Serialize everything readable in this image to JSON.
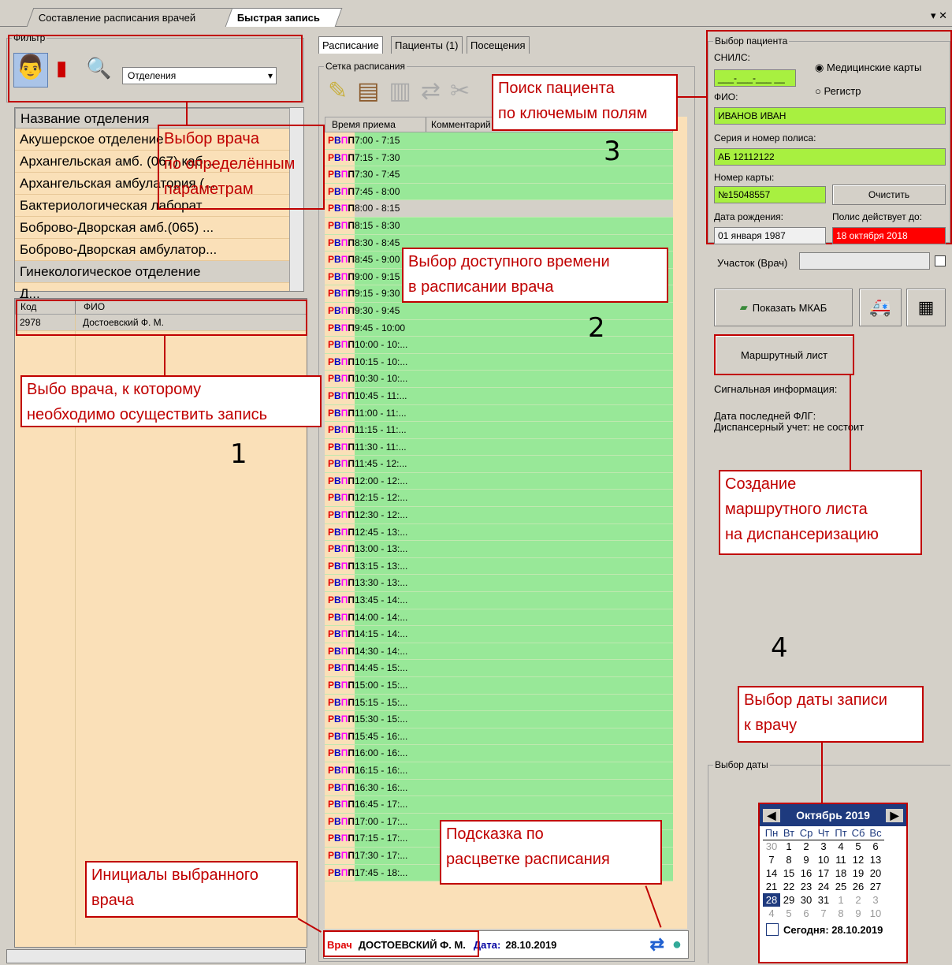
{
  "tabs": [
    "Составление расписания врачей",
    "Быстрая запись"
  ],
  "filter": {
    "title": "Фильтр",
    "select_value": "Отделения"
  },
  "departments": {
    "header": "Название отделения",
    "items": [
      "Акушерское отделение",
      "Архангельская амб. (067) каб...",
      "Архангельская амбулатория (...",
      "Бактериологическая лаборат...",
      "Боброво-Дворская амб.(065) ...",
      "Боброво-Дворская амбулатор...",
      "Гинекологическое отделение",
      "Д..."
    ]
  },
  "doctors": {
    "col_code": "Код",
    "col_fio": "ФИО",
    "rows": [
      {
        "code": "2978",
        "fio": "Достоевский Ф. М."
      }
    ]
  },
  "center_tabs": [
    "Расписание",
    "Пациенты (1)",
    "Посещения"
  ],
  "schedule": {
    "title": "Сетка расписания",
    "col_time": "Время приема",
    "col_comment": "Комментарий",
    "codes": [
      "Р",
      "В",
      "П",
      "П"
    ],
    "times": [
      "7:00 - 7:15",
      "7:15 - 7:30",
      "7:30 - 7:45",
      "7:45 - 8:00",
      "8:00 - 8:15",
      "8:15 - 8:30",
      "8:30 - 8:45",
      "8:45 - 9:00",
      "9:00 - 9:15",
      "9:15 - 9:30",
      "9:30 - 9:45",
      "9:45 - 10:00",
      "10:00 - 10:...",
      "10:15 - 10:...",
      "10:30 - 10:...",
      "10:45 - 11:...",
      "11:00 - 11:...",
      "11:15 - 11:...",
      "11:30 - 11:...",
      "11:45 - 12:...",
      "12:00 - 12:...",
      "12:15 - 12:...",
      "12:30 - 12:...",
      "12:45 - 13:...",
      "13:00 - 13:...",
      "13:15 - 13:...",
      "13:30 - 13:...",
      "13:45 - 14:...",
      "14:00 - 14:...",
      "14:15 - 14:...",
      "14:30 - 14:...",
      "14:45 - 15:...",
      "15:00 - 15:...",
      "15:15 - 15:...",
      "15:30 - 15:...",
      "15:45 - 16:...",
      "16:00 - 16:...",
      "16:15 - 16:...",
      "16:30 - 16:...",
      "16:45 - 17:...",
      "17:00 - 17:...",
      "17:15 - 17:...",
      "17:30 - 17:...",
      "17:45 - 18:..."
    ],
    "status_doctor_label": "Врач",
    "status_doctor": "ДОСТОЕВСКИЙ Ф. М.",
    "status_date_label": "Дата:",
    "status_date": "28.10.2019"
  },
  "patient": {
    "title": "Выбор пациента",
    "snils_label": "СНИЛС:",
    "snils": "___-___-___ __",
    "radio1": "Медицинские карты",
    "radio2": "Регистр",
    "fio_label": "ФИО:",
    "fio": "ИВАНОВ ИВАН",
    "policy_label": "Серия и номер полиса:",
    "policy": "АБ 12112122",
    "card_label": "Номер карты:",
    "card": "№15048557",
    "clear_btn": "Очистить",
    "birth_label": "Дата рождения:",
    "birth": "01 января 1987",
    "policy_valid_label": "Полис действует до:",
    "policy_valid": "18 октября 2018",
    "uchastok_label": "Участок (Врач)",
    "show_mkab": "Показать МКАБ",
    "route_btn": "Маршрутный лист",
    "signal": "Сигнальная информация:",
    "flg": "Дата последней ФЛГ:",
    "disp": "Диспансерный учет: не состоит"
  },
  "date_select": {
    "title": "Выбор даты",
    "month": "Октябрь 2019",
    "weekdays": [
      "Пн",
      "Вт",
      "Ср",
      "Чт",
      "Пт",
      "Сб",
      "Вс"
    ],
    "weeks": [
      [
        "30",
        "1",
        "2",
        "3",
        "4",
        "5",
        "6"
      ],
      [
        "7",
        "8",
        "9",
        "10",
        "11",
        "12",
        "13"
      ],
      [
        "14",
        "15",
        "16",
        "17",
        "18",
        "19",
        "20"
      ],
      [
        "21",
        "22",
        "23",
        "24",
        "25",
        "26",
        "27"
      ],
      [
        "28",
        "29",
        "30",
        "31",
        "1",
        "2",
        "3"
      ],
      [
        "4",
        "5",
        "6",
        "7",
        "8",
        "9",
        "10"
      ]
    ],
    "today": "Сегодня: 28.10.2019"
  },
  "callouts": {
    "c1": "Выбор врача\nпо определённым\nпараметрам",
    "c2": "Выбо врача, к которому\nнеобходимо осуществить запись",
    "c3": "Поиск пациента\nпо ключемым полям",
    "c4": "Выбор доступного времени\nв расписании врача",
    "c5": "Создание\nмаршрутного листа\nна диспансеризацию",
    "c6": "Выбор даты записи\nк врачу",
    "c7": "Подсказка по\nрасцветке расписания",
    "c8": "Инициалы выбранного\nврача"
  },
  "numbers": [
    "1",
    "2",
    "3",
    "4"
  ]
}
